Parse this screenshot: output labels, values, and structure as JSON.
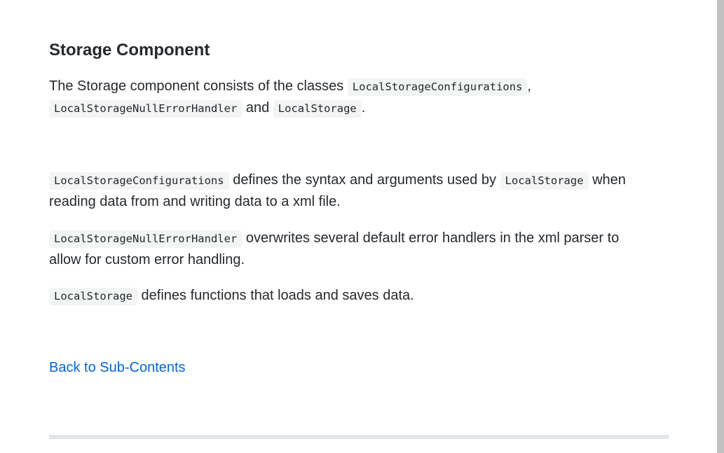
{
  "section": {
    "title": "Storage Component"
  },
  "paragraphs": {
    "intro": {
      "t1": "The Storage component consists of the classes ",
      "c1": "LocalStorageConfigurations",
      "t2": ", ",
      "c2": "LocalStorageNullErrorHandler",
      "t3": " and ",
      "c3": "LocalStorage",
      "t4": "."
    },
    "configurations": {
      "c1": "LocalStorageConfigurations",
      "t1": " defines the syntax and arguments used by ",
      "c2": "LocalStorage",
      "t2": " when reading data from and writing data to a xml file."
    },
    "null_handler": {
      "c1": "LocalStorageNullErrorHandler",
      "t1": " overwrites several default error handlers in the xml parser to allow for custom error handling."
    },
    "local_storage": {
      "c1": "LocalStorage",
      "t1": " defines functions that loads and saves data."
    }
  },
  "nav": {
    "back_link": "Back to Sub-Contents"
  },
  "colors": {
    "text": "#24292e",
    "link": "#0366d6",
    "code_bg": "#f3f4f4",
    "divider": "#e1e4e8"
  }
}
